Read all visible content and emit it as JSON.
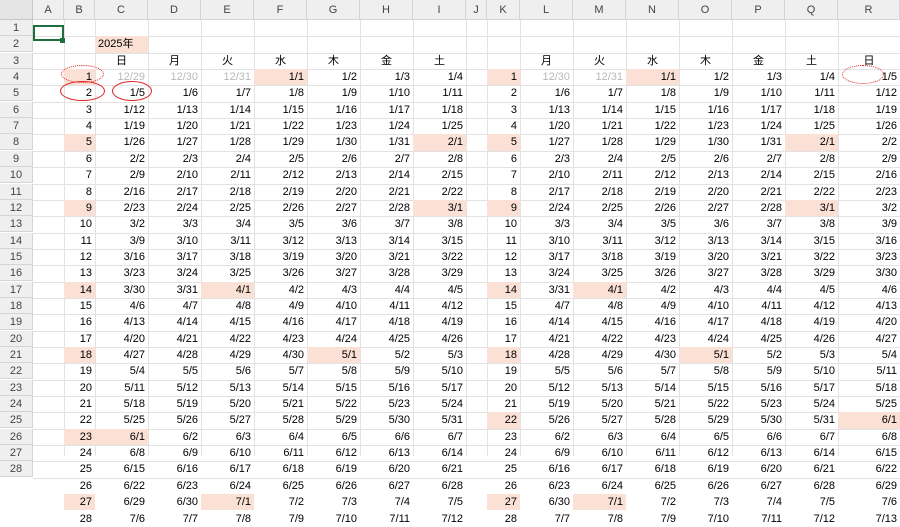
{
  "columns": [
    "A",
    "B",
    "C",
    "D",
    "E",
    "F",
    "G",
    "H",
    "I",
    "J",
    "K",
    "L",
    "M",
    "N",
    "O",
    "P",
    "Q",
    "R"
  ],
  "row_numbers": [
    1,
    2,
    3,
    4,
    5,
    6,
    7,
    8,
    9,
    10,
    11,
    12,
    13,
    14,
    15,
    16,
    17,
    18,
    19,
    20,
    21,
    22,
    23,
    24,
    25,
    26,
    27,
    28
  ],
  "highlight_color": "#fbe0d6",
  "annotation_color": "#e02020",
  "title": "2025年",
  "left_table": {
    "weekday_headers": [
      "日",
      "月",
      "火",
      "水",
      "木",
      "金",
      "土"
    ],
    "weeks": [
      {
        "w": "1",
        "d": [
          "12/29",
          "12/30",
          "12/31",
          "1/1",
          "1/2",
          "1/3",
          "1/4"
        ]
      },
      {
        "w": "2",
        "d": [
          "1/5",
          "1/6",
          "1/7",
          "1/8",
          "1/9",
          "1/10",
          "1/11"
        ]
      },
      {
        "w": "3",
        "d": [
          "1/12",
          "1/13",
          "1/14",
          "1/15",
          "1/16",
          "1/17",
          "1/18"
        ]
      },
      {
        "w": "4",
        "d": [
          "1/19",
          "1/20",
          "1/21",
          "1/22",
          "1/23",
          "1/24",
          "1/25"
        ]
      },
      {
        "w": "5",
        "d": [
          "1/26",
          "1/27",
          "1/28",
          "1/29",
          "1/30",
          "1/31",
          "2/1"
        ]
      },
      {
        "w": "6",
        "d": [
          "2/2",
          "2/3",
          "2/4",
          "2/5",
          "2/6",
          "2/7",
          "2/8"
        ]
      },
      {
        "w": "7",
        "d": [
          "2/9",
          "2/10",
          "2/11",
          "2/12",
          "2/13",
          "2/14",
          "2/15"
        ]
      },
      {
        "w": "8",
        "d": [
          "2/16",
          "2/17",
          "2/18",
          "2/19",
          "2/20",
          "2/21",
          "2/22"
        ]
      },
      {
        "w": "9",
        "d": [
          "2/23",
          "2/24",
          "2/25",
          "2/26",
          "2/27",
          "2/28",
          "3/1"
        ]
      },
      {
        "w": "10",
        "d": [
          "3/2",
          "3/3",
          "3/4",
          "3/5",
          "3/6",
          "3/7",
          "3/8"
        ]
      },
      {
        "w": "11",
        "d": [
          "3/9",
          "3/10",
          "3/11",
          "3/12",
          "3/13",
          "3/14",
          "3/15"
        ]
      },
      {
        "w": "12",
        "d": [
          "3/16",
          "3/17",
          "3/18",
          "3/19",
          "3/20",
          "3/21",
          "3/22"
        ]
      },
      {
        "w": "13",
        "d": [
          "3/23",
          "3/24",
          "3/25",
          "3/26",
          "3/27",
          "3/28",
          "3/29"
        ]
      },
      {
        "w": "14",
        "d": [
          "3/30",
          "3/31",
          "4/1",
          "4/2",
          "4/3",
          "4/4",
          "4/5"
        ]
      },
      {
        "w": "15",
        "d": [
          "4/6",
          "4/7",
          "4/8",
          "4/9",
          "4/10",
          "4/11",
          "4/12"
        ]
      },
      {
        "w": "16",
        "d": [
          "4/13",
          "4/14",
          "4/15",
          "4/16",
          "4/17",
          "4/18",
          "4/19"
        ]
      },
      {
        "w": "17",
        "d": [
          "4/20",
          "4/21",
          "4/22",
          "4/23",
          "4/24",
          "4/25",
          "4/26"
        ]
      },
      {
        "w": "18",
        "d": [
          "4/27",
          "4/28",
          "4/29",
          "4/30",
          "5/1",
          "5/2",
          "5/3"
        ]
      },
      {
        "w": "19",
        "d": [
          "5/4",
          "5/5",
          "5/6",
          "5/7",
          "5/8",
          "5/9",
          "5/10"
        ]
      },
      {
        "w": "20",
        "d": [
          "5/11",
          "5/12",
          "5/13",
          "5/14",
          "5/15",
          "5/16",
          "5/17"
        ]
      },
      {
        "w": "21",
        "d": [
          "5/18",
          "5/19",
          "5/20",
          "5/21",
          "5/22",
          "5/23",
          "5/24"
        ]
      },
      {
        "w": "22",
        "d": [
          "5/25",
          "5/26",
          "5/27",
          "5/28",
          "5/29",
          "5/30",
          "5/31"
        ]
      },
      {
        "w": "23",
        "d": [
          "6/1",
          "6/2",
          "6/3",
          "6/4",
          "6/5",
          "6/6",
          "6/7"
        ]
      },
      {
        "w": "24",
        "d": [
          "6/8",
          "6/9",
          "6/10",
          "6/11",
          "6/12",
          "6/13",
          "6/14"
        ]
      },
      {
        "w": "25",
        "d": [
          "6/15",
          "6/16",
          "6/17",
          "6/18",
          "6/19",
          "6/20",
          "6/21"
        ]
      },
      {
        "w": "26",
        "d": [
          "6/22",
          "6/23",
          "6/24",
          "6/25",
          "6/26",
          "6/27",
          "6/28"
        ]
      },
      {
        "w": "27",
        "d": [
          "6/29",
          "6/30",
          "7/1",
          "7/2",
          "7/3",
          "7/4",
          "7/5"
        ]
      },
      {
        "w": "28",
        "d": [
          "7/6",
          "7/7",
          "7/8",
          "7/9",
          "7/10",
          "7/11",
          "7/12"
        ]
      }
    ]
  },
  "right_table": {
    "weekday_headers": [
      "月",
      "火",
      "水",
      "木",
      "金",
      "土",
      "日"
    ],
    "weeks": [
      {
        "w": "1",
        "d": [
          "12/30",
          "12/31",
          "1/1",
          "1/2",
          "1/3",
          "1/4",
          "1/5"
        ]
      },
      {
        "w": "2",
        "d": [
          "1/6",
          "1/7",
          "1/8",
          "1/9",
          "1/10",
          "1/11",
          "1/12"
        ]
      },
      {
        "w": "3",
        "d": [
          "1/13",
          "1/14",
          "1/15",
          "1/16",
          "1/17",
          "1/18",
          "1/19"
        ]
      },
      {
        "w": "4",
        "d": [
          "1/20",
          "1/21",
          "1/22",
          "1/23",
          "1/24",
          "1/25",
          "1/26"
        ]
      },
      {
        "w": "5",
        "d": [
          "1/27",
          "1/28",
          "1/29",
          "1/30",
          "1/31",
          "2/1",
          "2/2"
        ]
      },
      {
        "w": "6",
        "d": [
          "2/3",
          "2/4",
          "2/5",
          "2/6",
          "2/7",
          "2/8",
          "2/9"
        ]
      },
      {
        "w": "7",
        "d": [
          "2/10",
          "2/11",
          "2/12",
          "2/13",
          "2/14",
          "2/15",
          "2/16"
        ]
      },
      {
        "w": "8",
        "d": [
          "2/17",
          "2/18",
          "2/19",
          "2/20",
          "2/21",
          "2/22",
          "2/23"
        ]
      },
      {
        "w": "9",
        "d": [
          "2/24",
          "2/25",
          "2/26",
          "2/27",
          "2/28",
          "3/1",
          "3/2"
        ]
      },
      {
        "w": "10",
        "d": [
          "3/3",
          "3/4",
          "3/5",
          "3/6",
          "3/7",
          "3/8",
          "3/9"
        ]
      },
      {
        "w": "11",
        "d": [
          "3/10",
          "3/11",
          "3/12",
          "3/13",
          "3/14",
          "3/15",
          "3/16"
        ]
      },
      {
        "w": "12",
        "d": [
          "3/17",
          "3/18",
          "3/19",
          "3/20",
          "3/21",
          "3/22",
          "3/23"
        ]
      },
      {
        "w": "13",
        "d": [
          "3/24",
          "3/25",
          "3/26",
          "3/27",
          "3/28",
          "3/29",
          "3/30"
        ]
      },
      {
        "w": "14",
        "d": [
          "3/31",
          "4/1",
          "4/2",
          "4/3",
          "4/4",
          "4/5",
          "4/6"
        ]
      },
      {
        "w": "15",
        "d": [
          "4/7",
          "4/8",
          "4/9",
          "4/10",
          "4/11",
          "4/12",
          "4/13"
        ]
      },
      {
        "w": "16",
        "d": [
          "4/14",
          "4/15",
          "4/16",
          "4/17",
          "4/18",
          "4/19",
          "4/20"
        ]
      },
      {
        "w": "17",
        "d": [
          "4/21",
          "4/22",
          "4/23",
          "4/24",
          "4/25",
          "4/26",
          "4/27"
        ]
      },
      {
        "w": "18",
        "d": [
          "4/28",
          "4/29",
          "4/30",
          "5/1",
          "5/2",
          "5/3",
          "5/4"
        ]
      },
      {
        "w": "19",
        "d": [
          "5/5",
          "5/6",
          "5/7",
          "5/8",
          "5/9",
          "5/10",
          "5/11"
        ]
      },
      {
        "w": "20",
        "d": [
          "5/12",
          "5/13",
          "5/14",
          "5/15",
          "5/16",
          "5/17",
          "5/18"
        ]
      },
      {
        "w": "21",
        "d": [
          "5/19",
          "5/20",
          "5/21",
          "5/22",
          "5/23",
          "5/24",
          "5/25"
        ]
      },
      {
        "w": "22",
        "d": [
          "5/26",
          "5/27",
          "5/28",
          "5/29",
          "5/30",
          "5/31",
          "6/1"
        ]
      },
      {
        "w": "23",
        "d": [
          "6/2",
          "6/3",
          "6/4",
          "6/5",
          "6/6",
          "6/7",
          "6/8"
        ]
      },
      {
        "w": "24",
        "d": [
          "6/9",
          "6/10",
          "6/11",
          "6/12",
          "6/13",
          "6/14",
          "6/15"
        ]
      },
      {
        "w": "25",
        "d": [
          "6/16",
          "6/17",
          "6/18",
          "6/19",
          "6/20",
          "6/21",
          "6/22"
        ]
      },
      {
        "w": "26",
        "d": [
          "6/23",
          "6/24",
          "6/25",
          "6/26",
          "6/27",
          "6/28",
          "6/29"
        ]
      },
      {
        "w": "27",
        "d": [
          "6/30",
          "7/1",
          "7/2",
          "7/3",
          "7/4",
          "7/5",
          "7/6"
        ]
      },
      {
        "w": "28",
        "d": [
          "7/7",
          "7/8",
          "7/9",
          "7/10",
          "7/11",
          "7/12",
          "7/13"
        ]
      }
    ]
  }
}
